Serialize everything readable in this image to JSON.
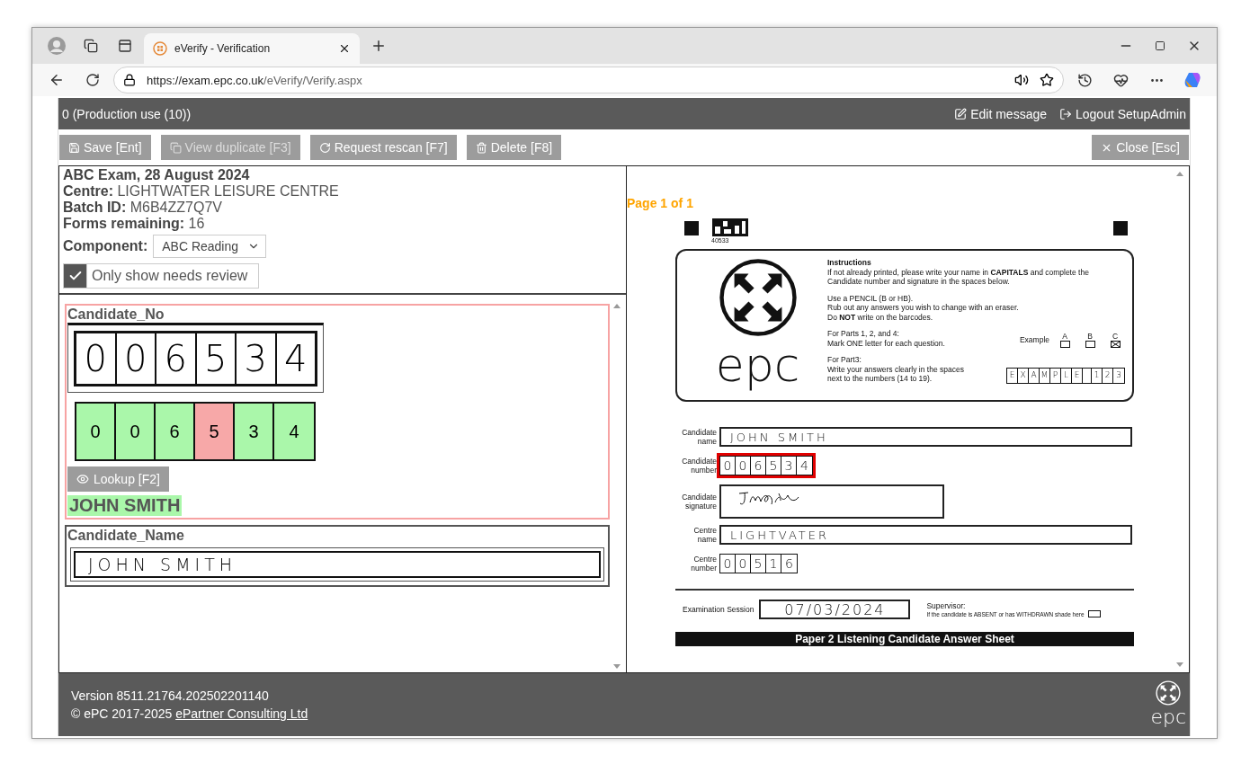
{
  "browser": {
    "tab_title": "eVerify - Verification",
    "url_host": "https://exam.epc.co.uk",
    "url_path": "/eVerify/Verify.aspx"
  },
  "header": {
    "title": "0 (Production use (10))",
    "edit_link": "Edit message",
    "logout_link": "Logout SetupAdmin"
  },
  "toolbar": {
    "save": {
      "label": "Save [Ent]",
      "disabled": false
    },
    "view_duplicate": {
      "label": "View duplicate [F3]",
      "disabled": true
    },
    "request_rescan": {
      "label": "Request rescan [F7]",
      "disabled": false
    },
    "delete": {
      "label": "Delete [F8]",
      "disabled": false
    },
    "close": {
      "label": "Close [Esc]",
      "disabled": false
    }
  },
  "batch": {
    "exam": "ABC Exam, 28 August 2024",
    "details": [
      {
        "label": "Centre:",
        "value": "LIGHTWATER LEISURE CENTRE"
      },
      {
        "label": "Batch ID:",
        "value": "M6B4ZZ7Q7V"
      },
      {
        "label": "Forms remaining:",
        "value": "16"
      }
    ],
    "component": {
      "label": "Component:",
      "value": "ABC Reading"
    },
    "needs_review": {
      "label": "Only show needs review",
      "checked": true
    }
  },
  "fields": [
    {
      "kind": "digits",
      "title": "Candidate_No",
      "flagged": true,
      "scan": [
        "0",
        "0",
        "6",
        "5",
        "3",
        "4"
      ],
      "digits": [
        {
          "value": "0",
          "color": "#aaf7aa"
        },
        {
          "value": "0",
          "color": "#aaf7aa"
        },
        {
          "value": "6",
          "color": "#aaf7aa"
        },
        {
          "value": "5",
          "color": "#f7a8a8"
        },
        {
          "value": "3",
          "color": "#aaf7aa"
        },
        {
          "value": "4",
          "color": "#aaf7aa"
        }
      ],
      "lookup_button": "Lookup [F2]",
      "match": "JOHN SMITH"
    },
    {
      "kind": "text",
      "title": "Candidate_Name",
      "flagged": false,
      "scan": "JOHN SMITH"
    }
  ],
  "viewer": {
    "page_label": "Page 1 of 1",
    "sheet": {
      "barcode_number": "40533",
      "logo": "epc",
      "instructions_title": "Instructions",
      "instructions": [
        [
          "If not already printed, please write your name in **CAPITALS** and complete the",
          "Candidate number and signature in the spaces below."
        ],
        [
          "Use a PENCIL (B or HB).",
          "Rub out any answers you wish to change with an eraser.",
          "Do **NOT** write on the barcodes."
        ],
        [
          "For Parts 1, 2, and 4:",
          "Mark ONE letter for each question."
        ],
        [
          "For Part3:",
          "Write your answers clearly in the spaces",
          "next to the numbers (14 to 19)."
        ]
      ],
      "example_label": "Example",
      "example_options": [
        {
          "letter": "A",
          "checked": false
        },
        {
          "letter": "B",
          "checked": false
        },
        {
          "letter": "C",
          "checked": true
        }
      ],
      "example_word": [
        "E",
        "X",
        "A",
        "M",
        "P",
        "L",
        "E"
      ],
      "example_number": [
        "1",
        "2",
        "3"
      ],
      "rows": [
        {
          "kind": "text",
          "label": "Candidate name",
          "value": "JOHN SMITH"
        },
        {
          "kind": "boxes",
          "label": "Candidate number",
          "boxes": [
            "0",
            "0",
            "6",
            "5",
            "3",
            "4"
          ],
          "highlighted": true
        },
        {
          "kind": "signature",
          "label": "Candidate signature"
        },
        {
          "kind": "text",
          "label": "Centre name",
          "value": "LIGHTVATER"
        },
        {
          "kind": "boxes",
          "label": "Centre number",
          "boxes": [
            "0",
            "0",
            "5",
            "1",
            "6"
          ],
          "highlighted": false
        }
      ],
      "session_label": "Examination Session",
      "session_value": "07/03/2024",
      "supervisor_label": "Supervisor:",
      "absent_note": "If the candidate is ABSENT or has WITHDRAWN shade here",
      "absent_shaded": false,
      "sheet_title": "Paper 2 Listening Candidate Answer Sheet"
    }
  },
  "footer": {
    "version": "Version 8511.21764.202502201140",
    "copyright": "© ePC 2017-2025",
    "company_link": "ePartner Consulting Ltd",
    "logo": "epc"
  }
}
